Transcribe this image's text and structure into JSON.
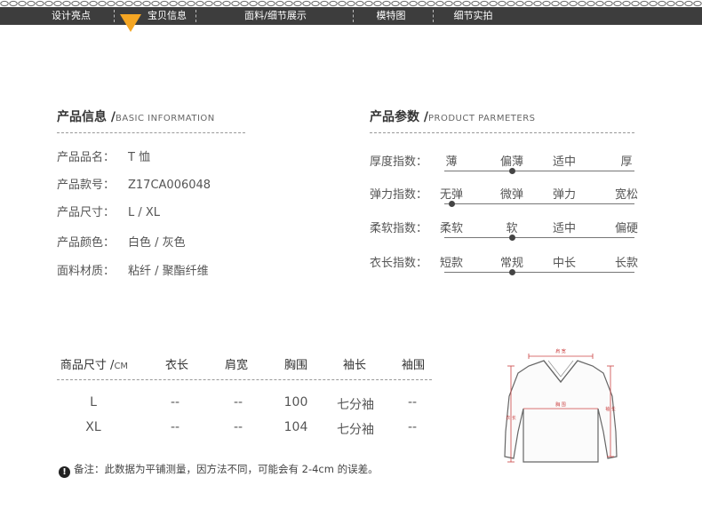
{
  "nav": {
    "items": [
      "设计亮点",
      "宝贝信息",
      "面料/细节展示",
      "模特图",
      "细节实拍"
    ],
    "active_index": 1,
    "accent_color": "#f5a623"
  },
  "info": {
    "title_cn": "产品信息 /",
    "title_en": "BASIC INFORMATION",
    "rows": [
      {
        "label": "产品品名：",
        "value": "T 恤"
      },
      {
        "label": "产品款号：",
        "value": "Z17CA006048"
      },
      {
        "label": "产品尺寸：",
        "value": "L / XL"
      },
      {
        "label": "产品颜色：",
        "value": "白色 / 灰色"
      },
      {
        "label": "面料材质：",
        "value": "粘纤 / 聚酯纤维"
      }
    ]
  },
  "params": {
    "title_cn": "产品参数 /",
    "title_en": "PRODUCT PARMETERS",
    "rows": [
      {
        "label": "厚度指数：",
        "options": [
          "薄",
          "偏薄",
          "适中",
          "厚"
        ],
        "selected": 1
      },
      {
        "label": "弹力指数：",
        "options": [
          "无弹",
          "微弹",
          "弹力",
          "宽松"
        ],
        "selected": 0
      },
      {
        "label": "柔软指数：",
        "options": [
          "柔软",
          "软",
          "适中",
          "偏硬"
        ],
        "selected": 1
      },
      {
        "label": "衣长指数：",
        "options": [
          "短款",
          "常规",
          "中长",
          "长款"
        ],
        "selected": 1
      }
    ]
  },
  "size_table": {
    "headers": [
      "商品尺寸 /",
      "衣长",
      "肩宽",
      "胸围",
      "袖长",
      "袖围"
    ],
    "unit": "CM",
    "rows": [
      [
        "L",
        "--",
        "--",
        "100",
        "七分袖",
        "--"
      ],
      [
        "XL",
        "--",
        "--",
        "104",
        "七分袖",
        "--"
      ]
    ]
  },
  "diagram": {
    "labels": {
      "shoulder": "肩 宽",
      "chest": "胸 围",
      "length": "衣 长",
      "sleeve": "袖 长"
    }
  },
  "note": {
    "icon": "exclamation-icon",
    "text": "备注：此数据为平铺测量，因方法不同，可能会有 2-4cm 的误差。"
  }
}
